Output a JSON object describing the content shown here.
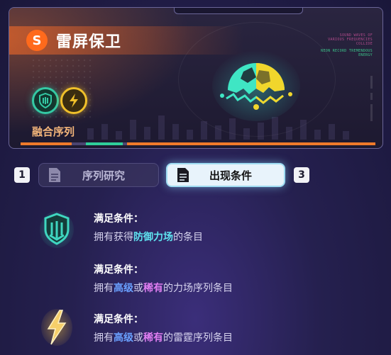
{
  "banner": {
    "title": "雷屏保卫",
    "logo_glyph": "S",
    "tiny_text_top": "SOUND WAVES OF VARIOUS FREQUENCIES COLLIDE",
    "tiny_text_mid": "NEON RECORD TREMENDOUS ENERGY",
    "fusion_label": "融合序列",
    "sequence_icons": [
      "shield-icon",
      "lightning-icon"
    ],
    "colors": {
      "accent_orange": "#ff6a1c",
      "shield_teal": "#34c9a4",
      "bolt_gold": "#f0c02a"
    }
  },
  "tabs": {
    "prev_key": "1",
    "next_key": "3",
    "items": [
      {
        "label": "序列研究",
        "active": false
      },
      {
        "label": "出现条件",
        "active": true
      }
    ]
  },
  "conditions": [
    {
      "icon": "shield-icon",
      "title": "满足条件：",
      "parts": [
        {
          "text": "拥有获得",
          "style": "normal"
        },
        {
          "text": "防御力场",
          "style": "cyan"
        },
        {
          "text": "的条目",
          "style": "normal"
        }
      ]
    },
    {
      "icon": "",
      "title": "满足条件：",
      "parts": [
        {
          "text": "拥有",
          "style": "normal"
        },
        {
          "text": "高级",
          "style": "blue"
        },
        {
          "text": "或",
          "style": "normal"
        },
        {
          "text": "稀有",
          "style": "pink"
        },
        {
          "text": "的力场序列条目",
          "style": "normal"
        }
      ]
    },
    {
      "icon": "lightning-icon",
      "title": "满足条件：",
      "parts": [
        {
          "text": "拥有",
          "style": "normal"
        },
        {
          "text": "高级",
          "style": "blue"
        },
        {
          "text": "或",
          "style": "normal"
        },
        {
          "text": "稀有",
          "style": "pink"
        },
        {
          "text": "的雷霆序列条目",
          "style": "normal"
        }
      ]
    }
  ]
}
